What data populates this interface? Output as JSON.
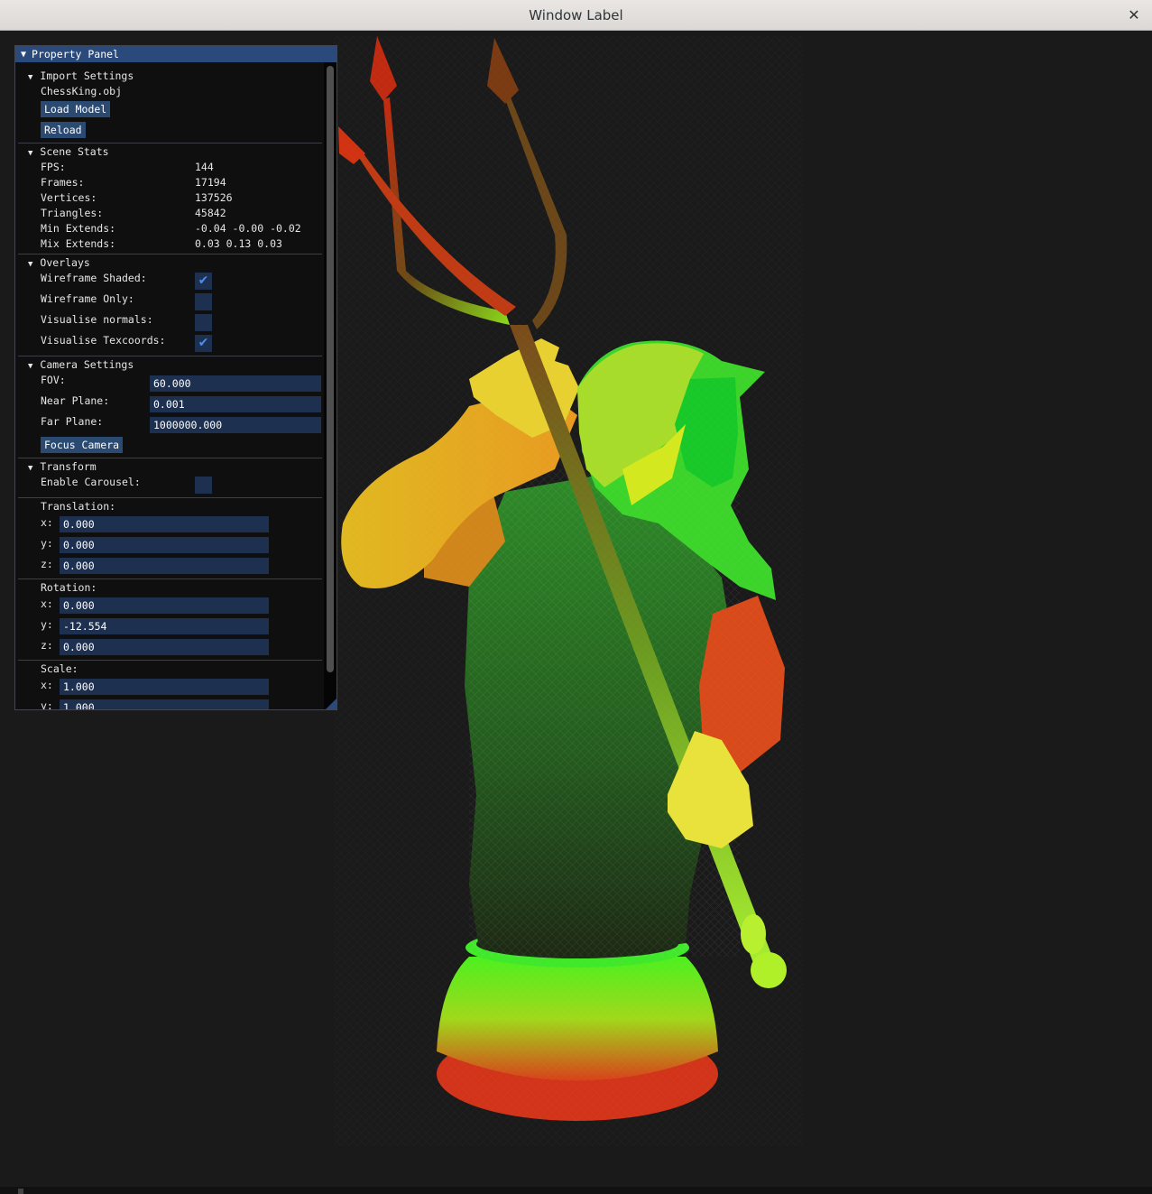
{
  "window": {
    "title": "Window Label",
    "close_glyph": "✕"
  },
  "panel": {
    "title": "Property Panel",
    "import_settings": {
      "header": "Import Settings",
      "filename": "ChessKing.obj",
      "load_button": "Load Model",
      "reload_button": "Reload"
    },
    "scene_stats": {
      "header": "Scene Stats",
      "rows": [
        {
          "label": "FPS:",
          "value": "144"
        },
        {
          "label": "Frames:",
          "value": "17194"
        },
        {
          "label": "Vertices:",
          "value": "137526"
        },
        {
          "label": "Triangles:",
          "value": "45842"
        },
        {
          "label": "Min Extends:",
          "value": "-0.04 -0.00 -0.02"
        },
        {
          "label": "Mix Extends:",
          "value": "0.03 0.13 0.03"
        }
      ]
    },
    "overlays": {
      "header": "Overlays",
      "items": [
        {
          "label": "Wireframe Shaded:",
          "checked": true
        },
        {
          "label": "Wireframe Only:",
          "checked": false
        },
        {
          "label": "Visualise normals:",
          "checked": false
        },
        {
          "label": "Visualise Texcoords:",
          "checked": true
        }
      ],
      "check_glyph": "✔"
    },
    "camera_settings": {
      "header": "Camera Settings",
      "fov_label": "FOV:",
      "fov_value": "60.000",
      "near_label": "Near Plane:",
      "near_value": "0.001",
      "far_label": "Far Plane:",
      "far_value": "1000000.000",
      "focus_button": "Focus Camera"
    },
    "transform": {
      "header": "Transform",
      "carousel_label": "Enable Carousel:",
      "carousel_checked": false,
      "translation": {
        "label": "Translation:",
        "x_label": "x:",
        "x": "0.000",
        "y_label": "y:",
        "y": "0.000",
        "z_label": "z:",
        "z": "0.000"
      },
      "rotation": {
        "label": "Rotation:",
        "x_label": "x:",
        "x": "0.000",
        "y_label": "y:",
        "y": "-12.554",
        "z_label": "z:",
        "z": "0.000"
      },
      "scale": {
        "label": "Scale:",
        "x_label": "x:",
        "x": "1.000",
        "y_label": "y:",
        "y": "1.000"
      }
    }
  },
  "colors": {
    "panel_title_bg": "#294a7a",
    "frame_bg": "#1e3050",
    "button_bg": "#2a4a72",
    "check_mark": "#4a8df0",
    "viewport_bg": "#1a1a1a"
  }
}
